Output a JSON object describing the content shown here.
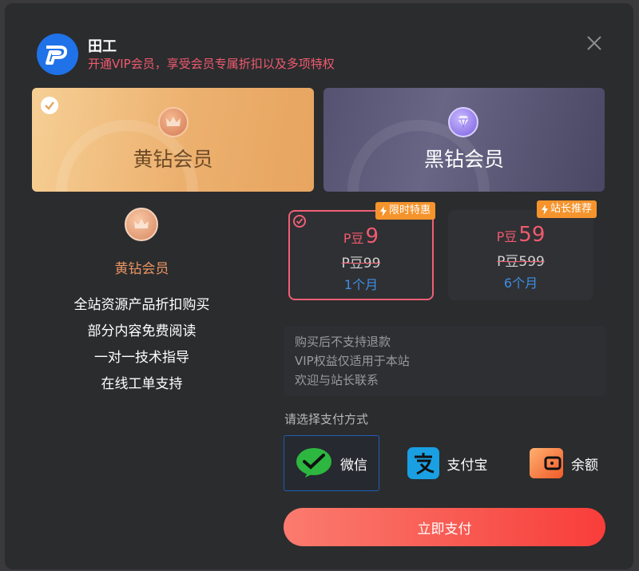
{
  "header": {
    "site_name": "田工",
    "subtitle": "开通VIP会员，享受会员专属折扣以及多项特权",
    "logo_text": "P"
  },
  "plans": [
    {
      "title": "黄钻会员",
      "icon": "crown-icon",
      "selected": true
    },
    {
      "title": "黑钻会员",
      "icon": "diamond-icon",
      "selected": false
    }
  ],
  "tier": {
    "name": "黄钻会员",
    "benefits": [
      "全站资源产品折扣购买",
      "部分内容免费阅读",
      "一对一技术指导",
      "在线工单支持"
    ]
  },
  "prices": [
    {
      "badge": "限时特惠",
      "currency": "P豆",
      "price": "9",
      "original": "P豆99",
      "period": "1个月",
      "selected": true
    },
    {
      "badge": "站长推荐",
      "currency": "P豆",
      "price": "59",
      "original": "P豆599",
      "period": "6个月",
      "selected": false
    }
  ],
  "notice": [
    "购买后不支持退款",
    "VIP权益仅适用于本站",
    "欢迎与站长联系"
  ],
  "payment": {
    "title": "请选择支付方式",
    "options": [
      {
        "label": "微信",
        "icon": "wechat-pay-icon",
        "selected": true
      },
      {
        "label": "支付宝",
        "icon": "alipay-icon",
        "selected": false
      },
      {
        "label": "余额",
        "icon": "wallet-icon",
        "selected": false
      }
    ],
    "submit_label": "立即支付"
  },
  "colors": {
    "accent": "#ef5a6f",
    "link": "#3d8fe8",
    "badge": "#f5942c",
    "gold": "#e89461"
  }
}
